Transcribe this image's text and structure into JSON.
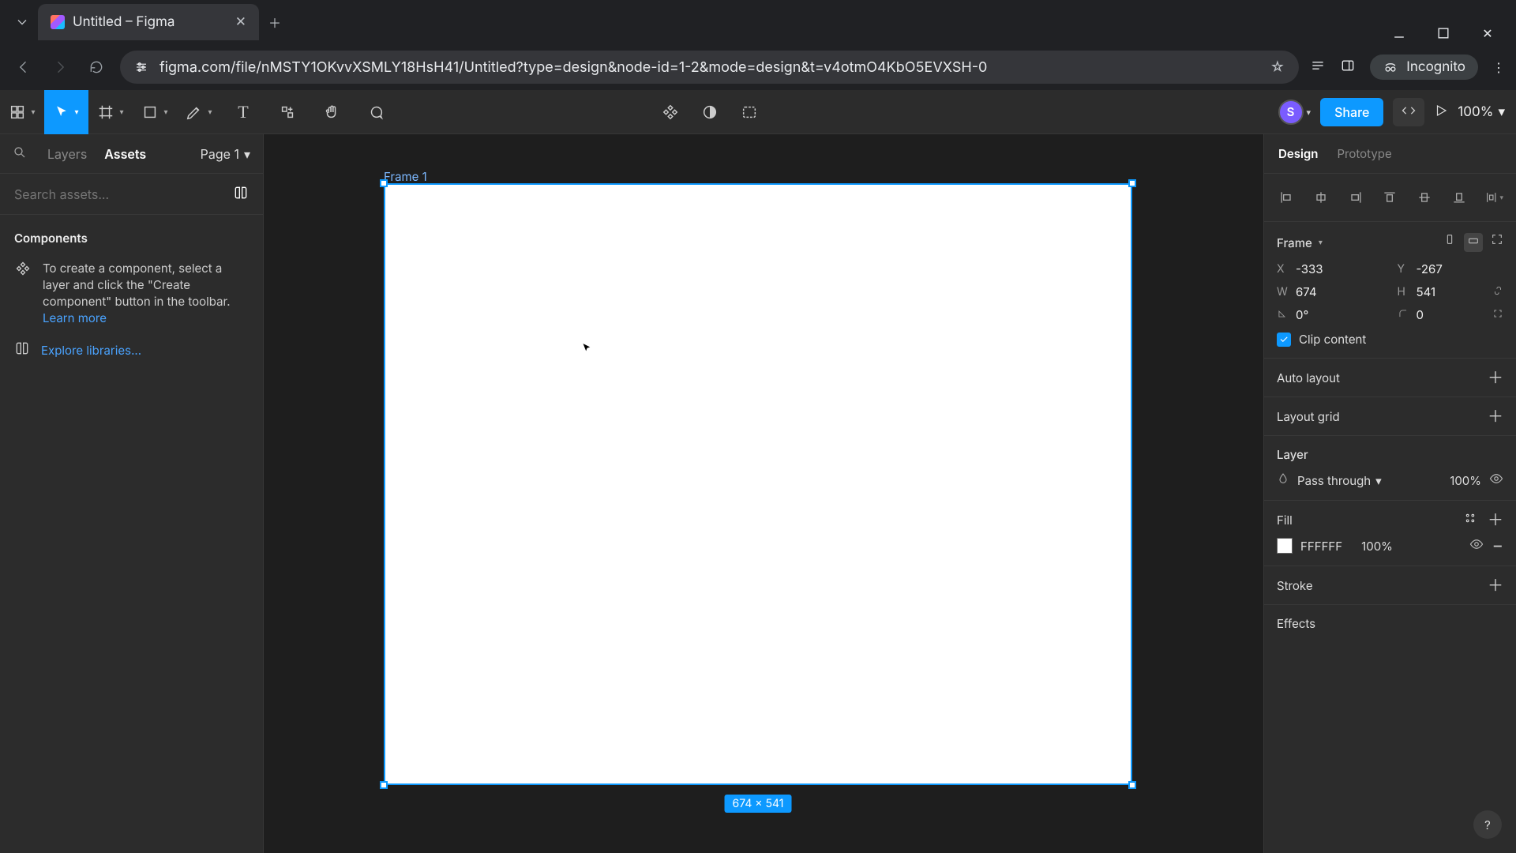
{
  "browser": {
    "tab_title": "Untitled – Figma",
    "url": "figma.com/file/nMSTY1OKvvXSMLY18HsH41/Untitled?type=design&node-id=1-2&mode=design&t=v4otmO4KbO5EVXSH-0",
    "incognito_label": "Incognito"
  },
  "toolbar": {
    "avatar_initial": "S",
    "share_label": "Share",
    "zoom": "100%"
  },
  "leftpanel": {
    "tab_layers": "Layers",
    "tab_assets": "Assets",
    "page_label": "Page 1",
    "search_placeholder": "Search assets...",
    "components_heading": "Components",
    "hint_text": "To create a component, select a layer and click the \"Create component\" button in the toolbar.",
    "learn_more": "Learn more",
    "explore_libraries": "Explore libraries..."
  },
  "canvas": {
    "frame_label": "Frame 1",
    "dim_badge": "674 × 541"
  },
  "rightpanel": {
    "tab_design": "Design",
    "tab_prototype": "Prototype",
    "frame_label": "Frame",
    "x_label": "X",
    "x_val": "-333",
    "y_label": "Y",
    "y_val": "-267",
    "w_label": "W",
    "w_val": "674",
    "h_label": "H",
    "h_val": "541",
    "rot_val": "0°",
    "radius_val": "0",
    "clip_label": "Clip content",
    "autolayout": "Auto layout",
    "layoutgrid": "Layout grid",
    "layer_heading": "Layer",
    "blend_mode": "Pass through",
    "layer_opacity": "100%",
    "fill_heading": "Fill",
    "fill_hex": "FFFFFF",
    "fill_opacity": "100%",
    "stroke_heading": "Stroke",
    "effects_heading": "Effects"
  }
}
